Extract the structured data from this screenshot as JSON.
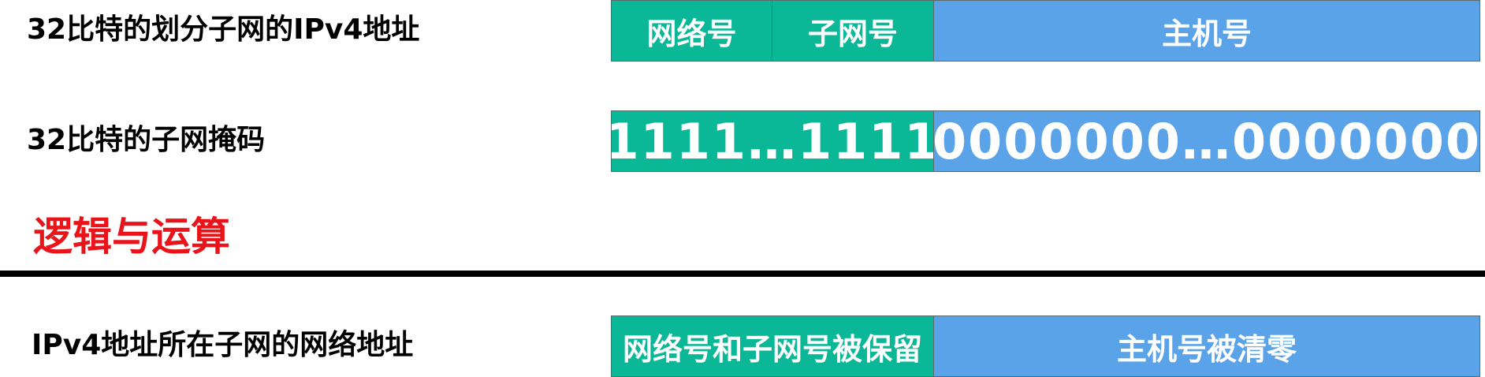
{
  "rows": {
    "address": {
      "label": "32比特的划分子网的IPv4地址",
      "network": "网络号",
      "subnet": "子网号",
      "host": "主机号"
    },
    "mask": {
      "label": "32比特的子网掩码",
      "ones": "1111…1111",
      "zeros": "0000000…0000000"
    },
    "operation": {
      "label": "逻辑与运算"
    },
    "result": {
      "label": "IPv4地址所在子网的网络地址",
      "kept": "网络号和子网号被保留",
      "cleared": "主机号被清零"
    }
  },
  "colors": {
    "green": "#0ab797",
    "blue": "#5aa3e8",
    "red": "#e8141a",
    "divider": "#000000"
  }
}
